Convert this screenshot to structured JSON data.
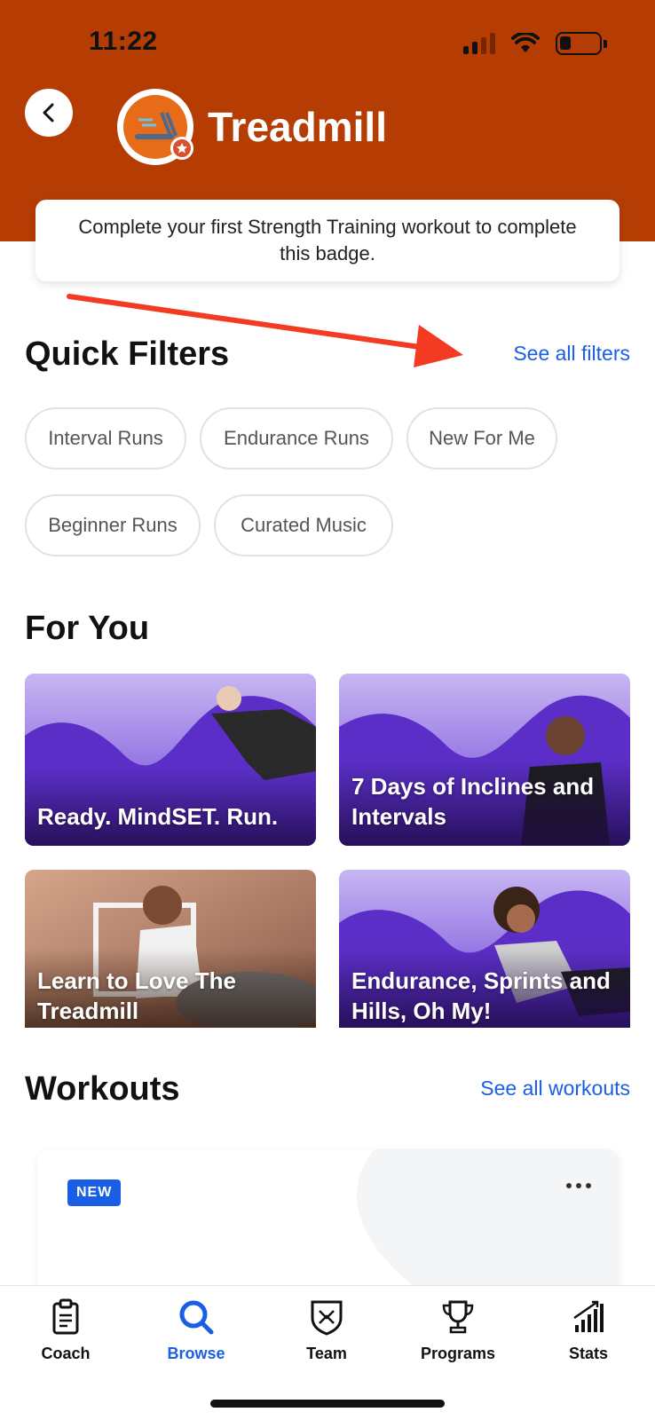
{
  "status_bar": {
    "time": "11:22"
  },
  "header": {
    "title": "Treadmill",
    "banner_text": "Complete your first Strength Training workout to complete this badge."
  },
  "quick_filters": {
    "title": "Quick Filters",
    "see_all": "See all filters",
    "chips": [
      "Interval Runs",
      "Endurance Runs",
      "New For Me",
      "Beginner Runs",
      "Curated Music"
    ]
  },
  "for_you": {
    "title": "For You",
    "cards": [
      {
        "label": "Ready. MindSET. Run."
      },
      {
        "label": "7 Days of Inclines and Intervals"
      },
      {
        "label": "Learn to Love The Treadmill"
      },
      {
        "label": "Endurance, Sprints and Hills, Oh My!"
      }
    ]
  },
  "workouts": {
    "title": "Workouts",
    "see_all": "See all workouts",
    "badge": "NEW"
  },
  "tabbar": {
    "active": "Browse",
    "tabs": [
      {
        "label": "Coach",
        "icon": "clipboard-icon"
      },
      {
        "label": "Browse",
        "icon": "search-icon"
      },
      {
        "label": "Team",
        "icon": "team-shield-icon"
      },
      {
        "label": "Programs",
        "icon": "trophy-icon"
      },
      {
        "label": "Stats",
        "icon": "stats-chart-icon"
      }
    ]
  },
  "colors": {
    "header": "#b53d04",
    "accent": "#1a5ee6",
    "annotation_arrow": "#f23b22",
    "card_purple": "#6a3fd6"
  }
}
